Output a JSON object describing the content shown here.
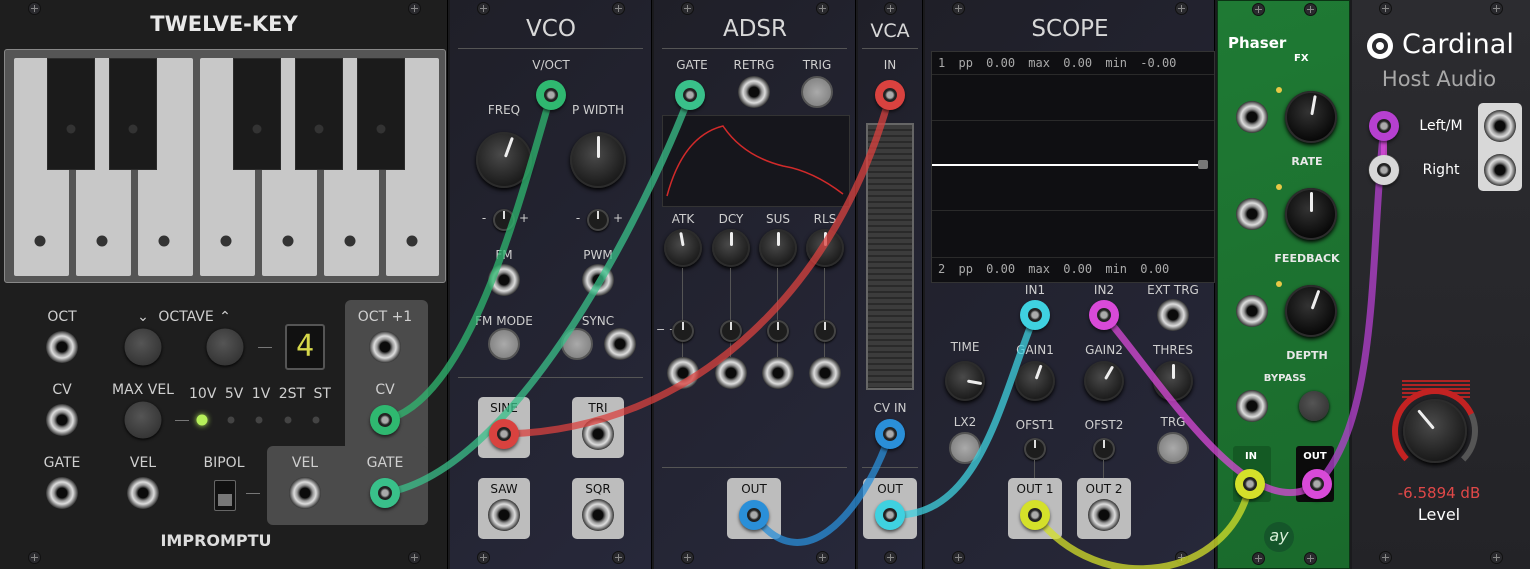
{
  "twelve_key": {
    "title": "TWELVE-KEY",
    "oct_label": "OCT",
    "octave_label": "OCTAVE",
    "octave_display": "4",
    "oct_plus_label": "OCT +1",
    "cv_label": "CV",
    "max_vel_label": "MAX VEL",
    "range_options": [
      "10V",
      "5V",
      "1V",
      "2ST",
      "ST"
    ],
    "gate_label": "GATE",
    "vel_label": "VEL",
    "bipol_label": "BIPOL",
    "vel_out_label": "VEL",
    "cv_out_label": "CV",
    "gate_out_label": "GATE",
    "brand": "IMPROMPTU"
  },
  "vco": {
    "title": "VCO",
    "voct": "V/OCT",
    "freq": "FREQ",
    "pwidth": "P WIDTH",
    "fm": "FM",
    "pwm": "PWM",
    "fm_mode": "FM MODE",
    "sync": "SYNC",
    "sine": "SINE",
    "tri": "TRI",
    "saw": "SAW",
    "sqr": "SQR"
  },
  "adsr": {
    "title": "ADSR",
    "gate": "GATE",
    "retrg": "RETRG",
    "trig": "TRIG",
    "atk": "ATK",
    "dcy": "DCY",
    "sus": "SUS",
    "rls": "RLS",
    "out": "OUT"
  },
  "vca": {
    "title": "VCA",
    "in": "IN",
    "cv_in": "CV IN",
    "out": "OUT"
  },
  "scope": {
    "title": "SCOPE",
    "ch1": {
      "num": "1",
      "pp": "pp",
      "pp_val": "0.00",
      "max": "max",
      "max_val": "0.00",
      "min": "min",
      "min_val": "-0.00"
    },
    "ch2": {
      "num": "2",
      "pp": "pp",
      "pp_val": "0.00",
      "max": "max",
      "max_val": "0.00",
      "min": "min",
      "min_val": "0.00"
    },
    "in1": "IN1",
    "in2": "IN2",
    "ext_trg": "EXT TRG",
    "time": "TIME",
    "gain1": "GAIN1",
    "gain2": "GAIN2",
    "thres": "THRES",
    "lx2": "LX2",
    "ofst1": "OFST1",
    "ofst2": "OFST2",
    "trg": "TRG",
    "out1": "OUT 1",
    "out2": "OUT 2"
  },
  "phaser": {
    "title": "Phaser",
    "sub": "FX",
    "rate": "RATE",
    "feedback": "FEEDBACK",
    "depth": "DEPTH",
    "bypass": "BYPASS",
    "in": "IN",
    "out": "OUT",
    "logo": "ay"
  },
  "cardinal": {
    "brand": "Cardinal",
    "subtitle": "Host Audio",
    "left": "Left/M",
    "right": "Right",
    "level_value": "-6.5894 dB",
    "level_label": "Level"
  },
  "cable_colors": {
    "green": "#2fb870",
    "teal": "#39c08a",
    "red": "#d9423f",
    "blue": "#2a8fd8",
    "cyan": "#3fd1e0",
    "magenta": "#d84ad8",
    "yellow": "#d4e02a",
    "purple": "#b640d0"
  }
}
